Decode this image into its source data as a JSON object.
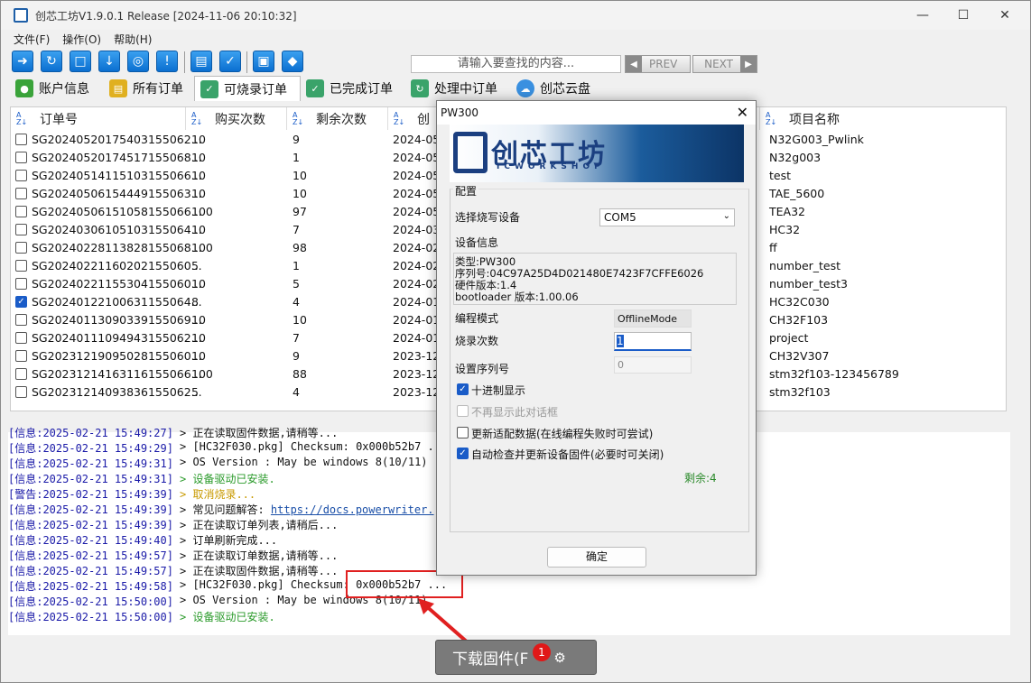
{
  "window": {
    "title": "创芯工坊V1.9.0.1 Release [2024-11-06 20:10:32]"
  },
  "menu": [
    "文件(F)",
    "操作(O)",
    "帮助(H)"
  ],
  "search": {
    "placeholder": "请输入要查找的内容..."
  },
  "nav": {
    "prev": "PREV",
    "next": "NEXT"
  },
  "tabs": [
    "账户信息",
    "所有订单",
    "可烧录订单",
    "已完成订单",
    "处理中订单",
    "创芯云盘"
  ],
  "table": {
    "headers": [
      "订单号",
      "购买次数",
      "剩余次数",
      "创",
      "项目名称"
    ],
    "rows": [
      {
        "order": "SG20240520175403155062...",
        "bought": "10",
        "remain": "9",
        "date": "2024-05",
        "project": "N32G003_Pwlink",
        "checked": false
      },
      {
        "order": "SG20240520174517155068...",
        "bought": "10",
        "remain": "1",
        "date": "2024-05",
        "project": "N32g003",
        "checked": false
      },
      {
        "order": "SG20240514115103155066...",
        "bought": "10",
        "remain": "10",
        "date": "2024-05",
        "project": "test",
        "checked": false
      },
      {
        "order": "SG20240506154449155063...",
        "bought": "10",
        "remain": "10",
        "date": "2024-05",
        "project": "TAE_5600",
        "checked": false
      },
      {
        "order": "SG20240506151058155066...",
        "bought": "100",
        "remain": "97",
        "date": "2024-05",
        "project": "TEA32",
        "checked": false
      },
      {
        "order": "SG20240306105103155064...",
        "bought": "10",
        "remain": "7",
        "date": "2024-03",
        "project": "HC32",
        "checked": false
      },
      {
        "order": "SG20240228113828155068...",
        "bought": "100",
        "remain": "98",
        "date": "2024-02",
        "project": "ff",
        "checked": false
      },
      {
        "order": "SG20240221160202155060...",
        "bought": "5",
        "remain": "1",
        "date": "2024-02",
        "project": "number_test",
        "checked": false
      },
      {
        "order": "SG20240221155304155060...",
        "bought": "10",
        "remain": "5",
        "date": "2024-02",
        "project": "number_test3",
        "checked": false
      },
      {
        "order": "SG20240122100631155064...",
        "bought": "8",
        "remain": "4",
        "date": "2024-01",
        "project": "HC32C030",
        "checked": true
      },
      {
        "order": "SG20240113090339155069...",
        "bought": "10",
        "remain": "10",
        "date": "2024-01",
        "project": "CH32F103",
        "checked": false
      },
      {
        "order": "SG20240111094943155062...",
        "bought": "10",
        "remain": "7",
        "date": "2024-01",
        "project": "project",
        "checked": false
      },
      {
        "order": "SG20231219095028155060...",
        "bought": "10",
        "remain": "9",
        "date": "2023-12",
        "project": "CH32V307",
        "checked": false
      },
      {
        "order": "SG20231214163116155066...",
        "bought": "100",
        "remain": "88",
        "date": "2023-12",
        "project": "stm32f103-123456789",
        "checked": false
      },
      {
        "order": "SG20231214093836155062...",
        "bought": "5",
        "remain": "4",
        "date": "2023-12",
        "project": "stm32f103",
        "checked": false
      }
    ]
  },
  "log": [
    {
      "lv": "[信息:",
      "ts": "2025-02-21 15:49:27]",
      "msg": "> 正在读取固件数据,请稍等...",
      "cls": ""
    },
    {
      "lv": "[信息:",
      "ts": "2025-02-21 15:49:29]",
      "msg": "> [HC32F030.pkg]  Checksum: 0x000b52b7 ...",
      "cls": ""
    },
    {
      "lv": "[信息:",
      "ts": "2025-02-21 15:49:31]",
      "msg": "> OS Version : May be windows 8(10/11)",
      "cls": ""
    },
    {
      "lv": "[信息:",
      "ts": "2025-02-21 15:49:31]",
      "msg": "> 设备驱动已安装.",
      "cls": "green"
    },
    {
      "lv": "[警告:",
      "ts": "2025-02-21 15:49:39]",
      "msg": "> 取消烧录...",
      "cls": "orange"
    },
    {
      "lv": "[信息:",
      "ts": "2025-02-21 15:49:39]",
      "msg": "> 常见问题解答: ",
      "link": "https://docs.powerwriter.",
      "cls": ""
    },
    {
      "lv": "[信息:",
      "ts": "2025-02-21 15:49:39]",
      "msg": "> 正在读取订单列表,请稍后...",
      "cls": ""
    },
    {
      "lv": "[信息:",
      "ts": "2025-02-21 15:49:40]",
      "msg": "> 订单刷新完成...",
      "cls": ""
    },
    {
      "lv": "[信息:",
      "ts": "2025-02-21 15:49:57]",
      "msg": "> 正在读取订单数据,请稍等...",
      "cls": ""
    },
    {
      "lv": "[信息:",
      "ts": "2025-02-21 15:49:57]",
      "msg": "> 正在读取固件数据,请稍等...",
      "cls": ""
    },
    {
      "lv": "[信息:",
      "ts": "2025-02-21 15:49:58]",
      "msg": "> [HC32F030.pkg]  Checksum: 0x000b52b7 ...",
      "cls": ""
    },
    {
      "lv": "[信息:",
      "ts": "2025-02-21 15:50:00]",
      "msg": "> OS Version : May be windows 8(10/11)",
      "cls": ""
    },
    {
      "lv": "[信息:",
      "ts": "2025-02-21 15:50:00]",
      "msg": "> 设备驱动已安装.",
      "cls": "green"
    }
  ],
  "download": {
    "label": "下载固件(F",
    "badge": "1"
  },
  "dialog": {
    "title": "PW300",
    "logo_text": "创芯工坊",
    "logo_sub": "ICWORKSHOP",
    "group_label": "配置",
    "select_device_label": "选择烧写设备",
    "device_value": "COM5",
    "device_info_label": "设备信息",
    "device_info": [
      "类型:PW300",
      "序列号:04C97A25D4D021480E7423F7CFFE6026",
      "硬件版本:1.4",
      "bootloader 版本:1.00.06"
    ],
    "mode_label": "编程模式",
    "mode_value": "OfflineMode",
    "count_label": "烧录次数",
    "count_value": "1",
    "serial_label": "设置序列号",
    "serial_value": "0",
    "opt_hex": "十进制显示",
    "opt_noshow": "不再显示此对话框",
    "opt_update": "更新适配数据(在线编程失败时可尝试)",
    "opt_autocheck": "自动检查并更新设备固件(必要时可关闭)",
    "remain": "剩余:4",
    "ok": "确定"
  }
}
